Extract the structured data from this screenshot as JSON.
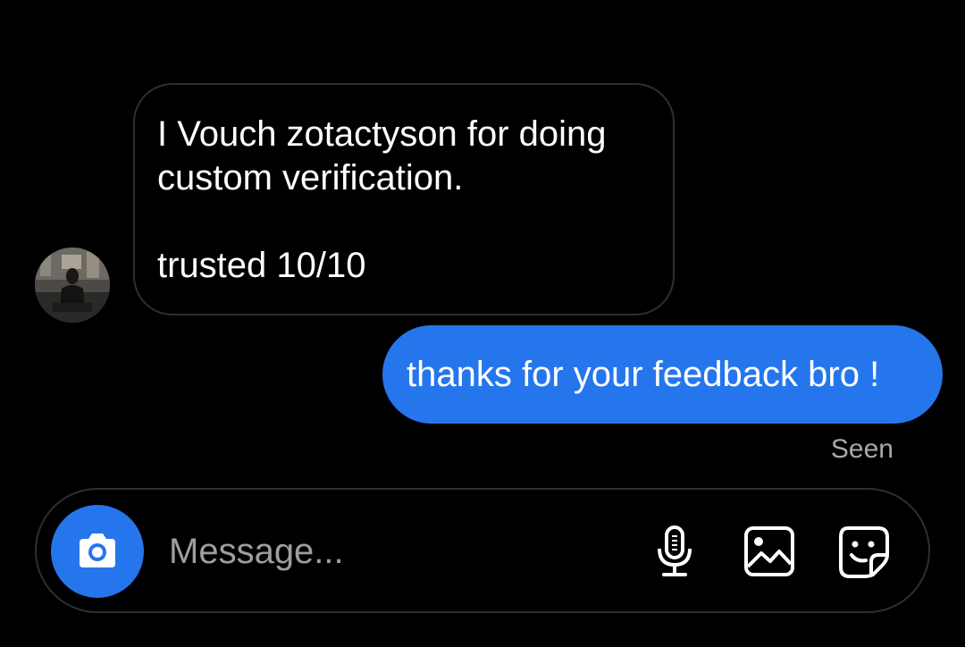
{
  "thread": {
    "incoming_message": "I Vouch zotactyson for doing\ncustom verification.\n\ntrusted 10/10",
    "outgoing_message": "thanks for your feedback bro !",
    "seen_label": "Seen"
  },
  "composer": {
    "placeholder": "Message...",
    "value": ""
  },
  "colors": {
    "accent": "#2576ec",
    "background": "#000000",
    "bubble_border": "#2f2f2f",
    "muted_text": "#a8a8a8"
  },
  "icons": {
    "avatar": "user-avatar",
    "camera": "camera-icon",
    "mic": "microphone-icon",
    "gallery": "gallery-icon",
    "sticker": "sticker-icon"
  }
}
